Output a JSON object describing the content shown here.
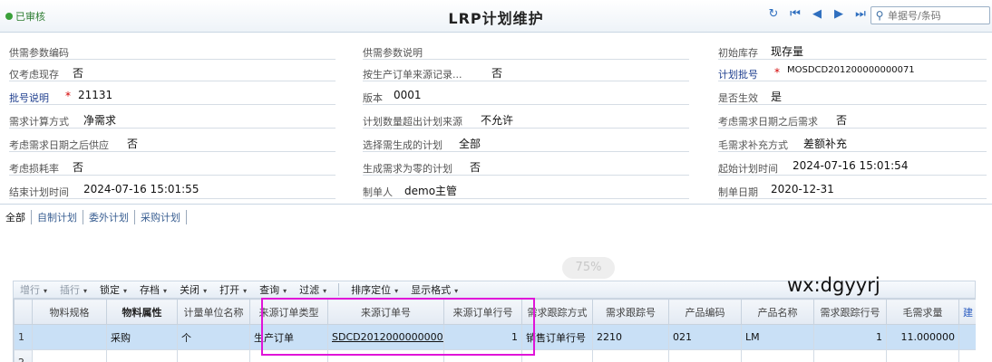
{
  "header": {
    "status": "已审核",
    "title": "LRP计划维护",
    "nav": [
      "↻",
      "⏮",
      "◀",
      "▶",
      "⏭"
    ],
    "search_placeholder": "单据号/条码"
  },
  "form": {
    "col1": [
      {
        "label": "供需参数编码",
        "value": ""
      },
      {
        "label": "仅考虑现存",
        "value": "否"
      },
      {
        "label": "批号说明",
        "value": "21131",
        "required": true,
        "blue": true
      },
      {
        "label": "需求计算方式",
        "value": "净需求"
      },
      {
        "label": "考虑需求日期之后供应",
        "value": "否"
      },
      {
        "label": "考虑损耗率",
        "value": "否"
      },
      {
        "label": "结束计划时间",
        "value": "2024-07-16 15:01:55"
      }
    ],
    "col2": [
      {
        "label": "供需参数说明",
        "value": ""
      },
      {
        "label": "按生产订单来源记录...",
        "value": "否"
      },
      {
        "label": "版本",
        "value": "0001"
      },
      {
        "label": "计划数量超出计划来源",
        "value": "不允许"
      },
      {
        "label": "选择需生成的计划",
        "value": "全部"
      },
      {
        "label": "生成需求为零的计划",
        "value": "否"
      },
      {
        "label": "制单人",
        "value": "demo主管"
      }
    ],
    "col3": [
      {
        "label": "初始库存",
        "value": "现存量"
      },
      {
        "label": "计划批号",
        "value": "MOSDCD201200000000071",
        "required": true,
        "blue": true
      },
      {
        "label": "是否生效",
        "value": "是"
      },
      {
        "label": "考虑需求日期之后需求",
        "value": "否"
      },
      {
        "label": "毛需求补充方式",
        "value": "差额补充"
      },
      {
        "label": "起始计划时间",
        "value": "2024-07-16 15:01:54"
      },
      {
        "label": "制单日期",
        "value": "2020-12-31"
      }
    ]
  },
  "tabs": [
    "全部",
    "自制计划",
    "委外计划",
    "采购计划"
  ],
  "zoom_watermark": "75%",
  "toolbar": [
    {
      "label": "增行",
      "dim": true,
      "caret": true
    },
    {
      "label": "插行",
      "dim": true,
      "caret": true
    },
    {
      "label": "锁定",
      "caret": true
    },
    {
      "label": "存档",
      "caret": true
    },
    {
      "label": "关闭",
      "caret": true
    },
    {
      "label": "打开",
      "caret": true
    },
    {
      "label": "查询",
      "caret": true
    },
    {
      "label": "过滤",
      "caret": true
    },
    {
      "label": "排序定位",
      "caret": true,
      "sep_before": true
    },
    {
      "label": "显示格式",
      "caret": true
    }
  ],
  "watermark_text": "wx:dgyyrj",
  "grid": {
    "columns": [
      "",
      "物料规格",
      "物料属性",
      "计量单位名称",
      "来源订单类型",
      "来源订单号",
      "来源订单行号",
      "需求跟踪方式",
      "需求跟踪号",
      "产品编码",
      "产品名称",
      "需求跟踪行号",
      "毛需求量",
      "建"
    ],
    "rows": [
      [
        "1",
        "",
        "采购",
        "个",
        "生产订单",
        "SDCD20120000000007",
        "1",
        "销售订单行号",
        "2210",
        "021",
        "LM",
        "1",
        "11.000000",
        ""
      ],
      [
        "2",
        "",
        "",
        "",
        "",
        "",
        "",
        "",
        "",
        "",
        "",
        "",
        "",
        ""
      ]
    ]
  },
  "colors": {
    "highlight": "#e014d8",
    "selected_row": "#c9e0f6",
    "required": "#d40000"
  }
}
